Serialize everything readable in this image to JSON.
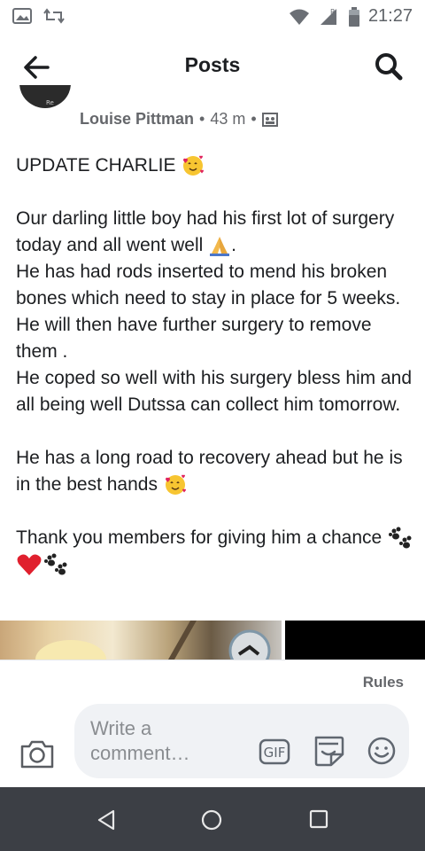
{
  "status_bar": {
    "time": "21:27",
    "icons": [
      "gallery-icon",
      "retweet-icon",
      "wifi-icon",
      "signal-icon",
      "battery-icon"
    ]
  },
  "header": {
    "title": "Posts",
    "back_icon": "arrow-left-icon",
    "search_icon": "search-icon"
  },
  "post": {
    "author": "Louise Pittman",
    "sep1": "•",
    "time": "43 m",
    "sep2": "•",
    "privacy_icon": "group-icon",
    "lines": {
      "l1": "UPDATE CHARLIE",
      "l2": "Our darling little boy had his first lot of surgery today and all went well",
      "l2_end": ".",
      "l3": "He has had rods inserted to mend his broken bones which need to stay in place for 5 weeks.  He will then have further surgery to remove them .",
      "l4": "He coped so well with his surgery bless him and all being well Dutssa can collect him tomorrow.",
      "l5": "He has a long road to recovery ahead but he is in the best hands",
      "l6": "Thank you members for giving him a chance"
    }
  },
  "comments": {
    "rules_label": "Rules",
    "placeholder": "Write a comment…",
    "gif_label": "GIF"
  },
  "colors": {
    "text": "#1c1e21",
    "muted": "#65676b",
    "composer_bg": "#f0f2f5",
    "nav_bg": "#3c3f45"
  }
}
